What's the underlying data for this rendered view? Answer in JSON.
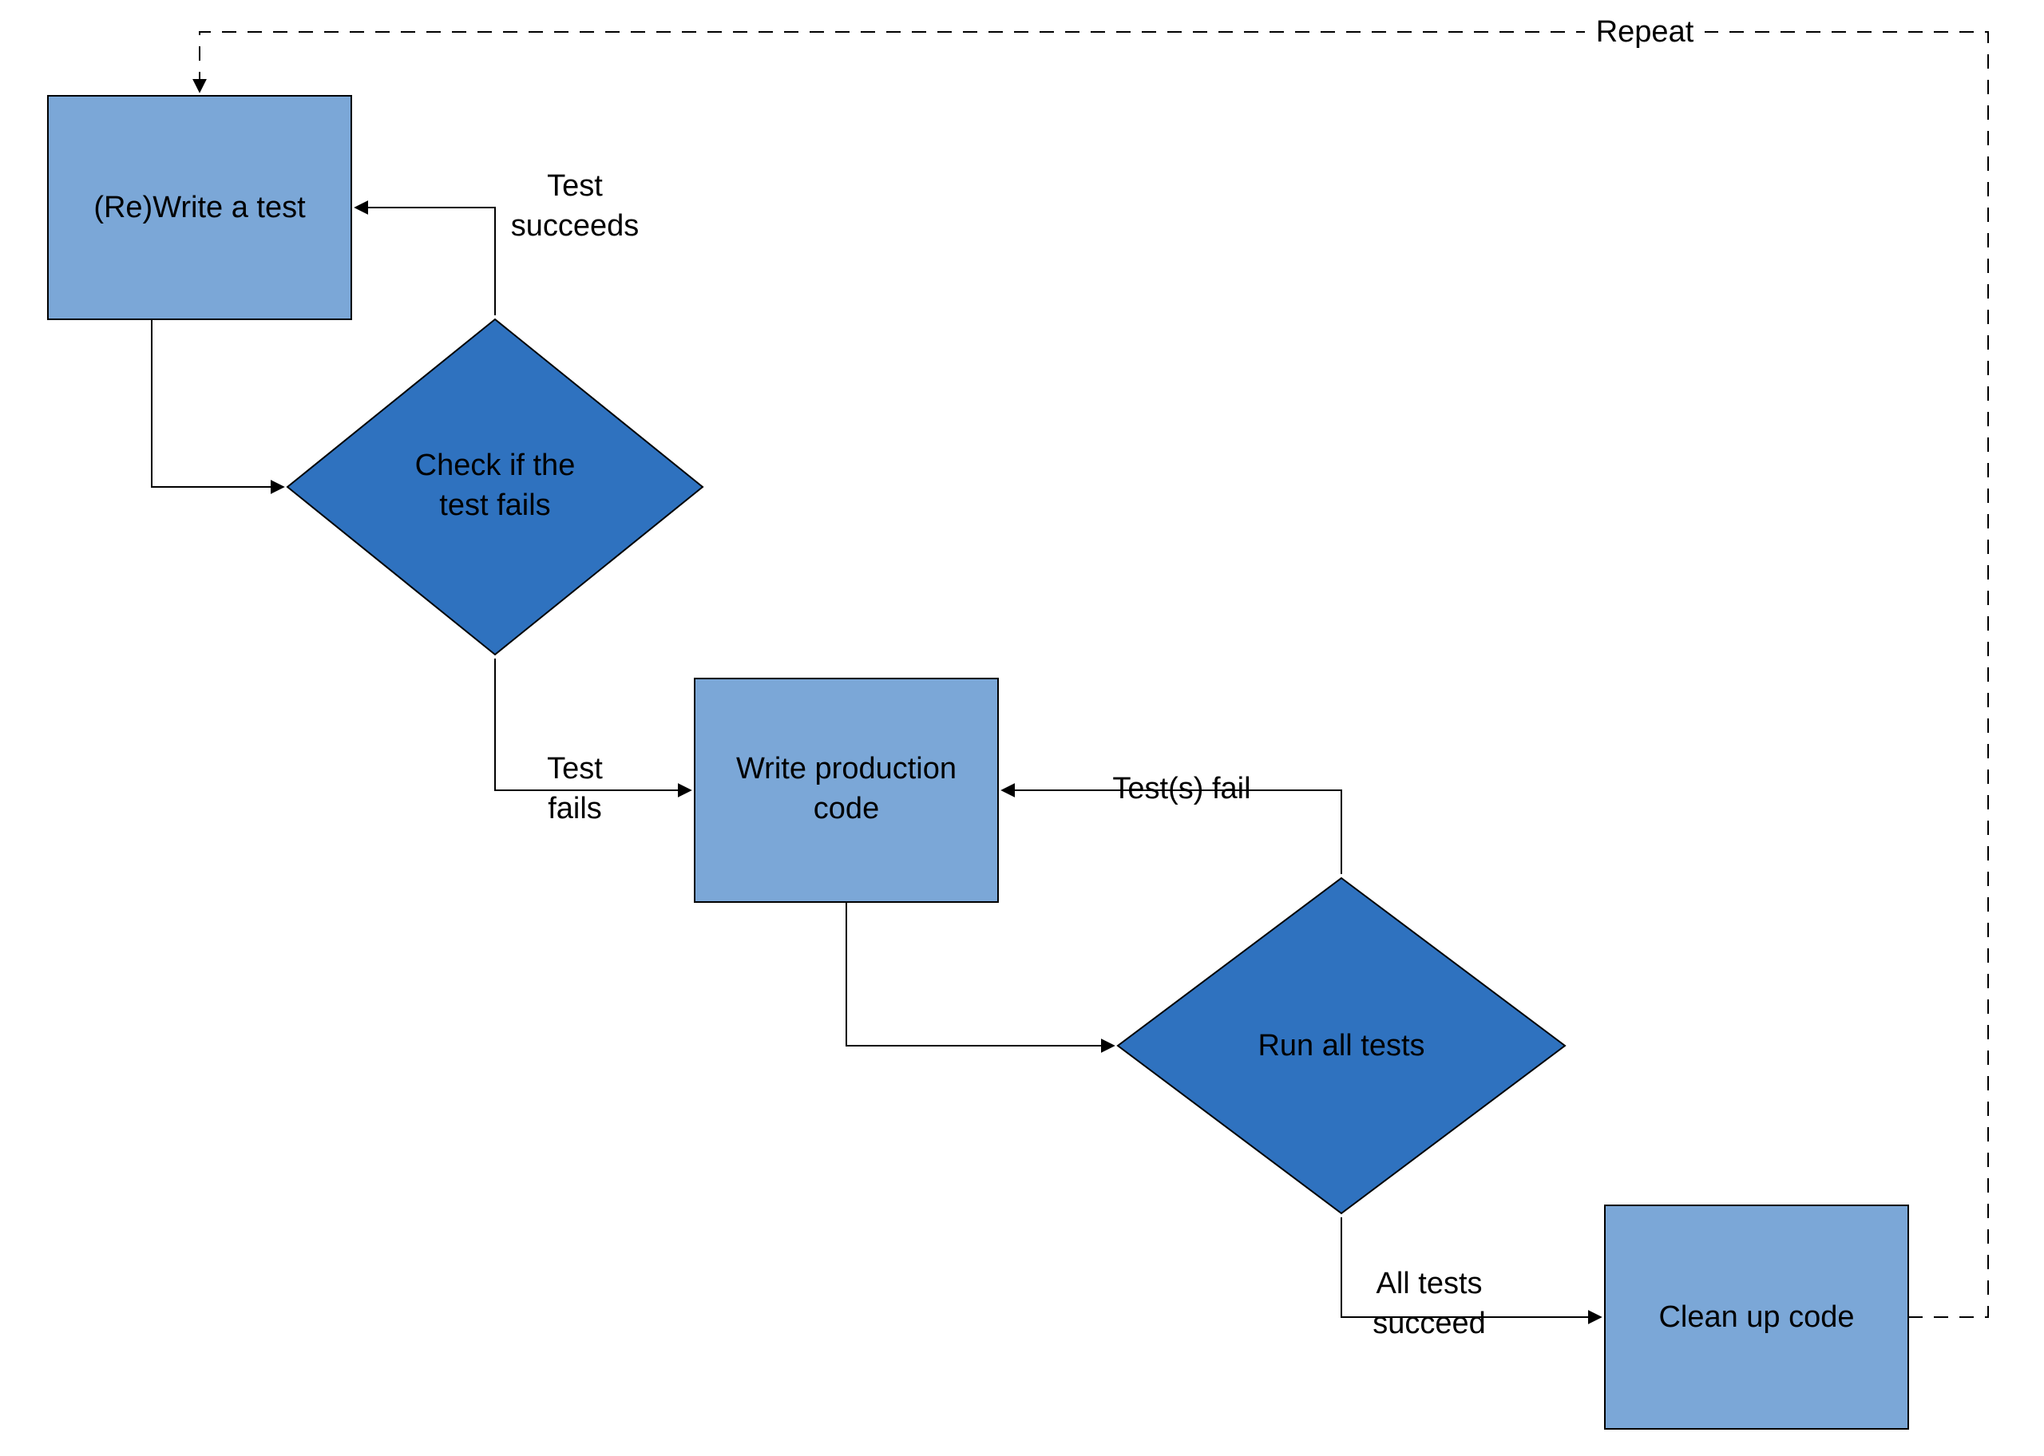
{
  "nodes": {
    "rewrite": {
      "label1": "(Re)Write a test"
    },
    "checkfail": {
      "label1": "Check if the",
      "label2": "test fails"
    },
    "writeprod": {
      "label1": "Write production",
      "label2": "code"
    },
    "runall": {
      "label1": "Run all tests"
    },
    "cleanup": {
      "label1": "Clean up code"
    }
  },
  "edges": {
    "test_succeeds": {
      "label1": "Test",
      "label2": "succeeds"
    },
    "test_fails": {
      "label1": "Test",
      "label2": "fails"
    },
    "tests_fail": {
      "label1": "Test(s) fail"
    },
    "all_succeed": {
      "label1": "All tests",
      "label2": "succeed"
    },
    "repeat": {
      "label1": "Repeat"
    }
  },
  "colors": {
    "light_box": "#7ba7d7",
    "dark_box": "#2f72bf",
    "stroke": "#000000"
  }
}
